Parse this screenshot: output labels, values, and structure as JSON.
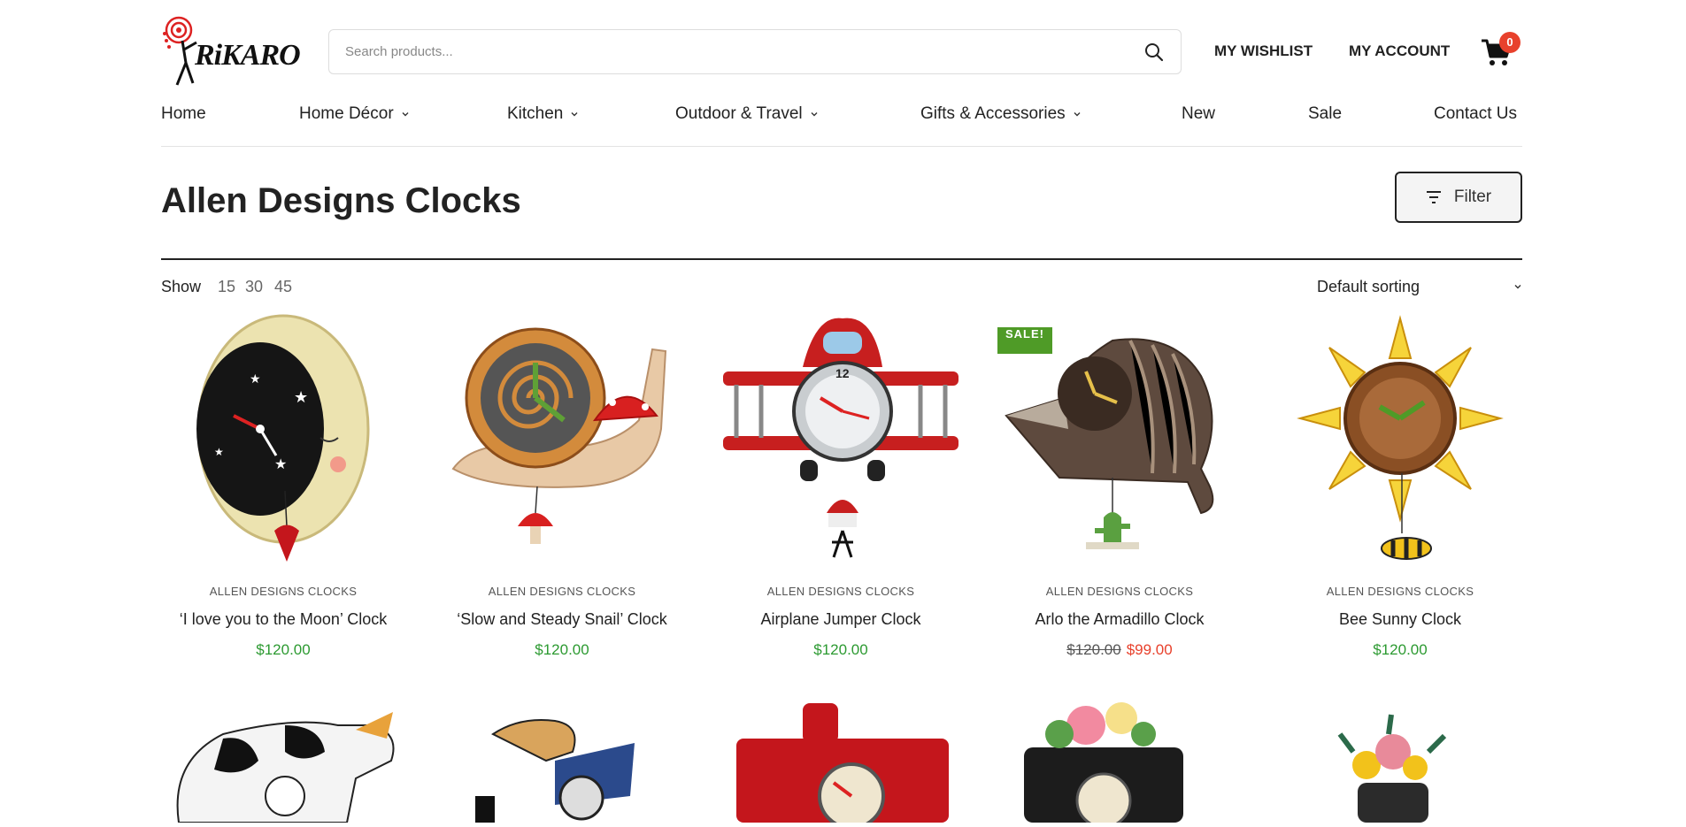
{
  "brand": {
    "logo_text": "RiKARO"
  },
  "search": {
    "placeholder": "Search products..."
  },
  "header": {
    "wishlist": "MY WISHLIST",
    "account": "MY ACCOUNT",
    "cart_count": "0"
  },
  "nav": [
    {
      "label": "Home"
    },
    {
      "label": "Home Décor"
    },
    {
      "label": "Kitchen"
    },
    {
      "label": "Outdoor & Travel"
    },
    {
      "label": "Gifts & Accessories"
    },
    {
      "label": "New"
    },
    {
      "label": "Sale"
    },
    {
      "label": "Contact Us"
    }
  ],
  "page": {
    "title": "Allen Designs Clocks",
    "filter_label": "Filter"
  },
  "toolbar": {
    "show_label": "Show",
    "show_options": [
      "15",
      "30",
      "45"
    ],
    "sort_label": "Default sorting"
  },
  "products": [
    {
      "category": "ALLEN DESIGNS CLOCKS",
      "name": "‘I love you to the Moon’ Clock",
      "price": "$120.00"
    },
    {
      "category": "ALLEN DESIGNS CLOCKS",
      "name": "‘Slow and Steady Snail’ Clock",
      "price": "$120.00"
    },
    {
      "category": "ALLEN DESIGNS CLOCKS",
      "name": "Airplane Jumper Clock",
      "price": "$120.00"
    },
    {
      "category": "ALLEN DESIGNS CLOCKS",
      "name": "Arlo the Armadillo Clock",
      "old_price": "$120.00",
      "price": "$99.00",
      "badge": "SALE!"
    },
    {
      "category": "ALLEN DESIGNS CLOCKS",
      "name": "Bee Sunny Clock",
      "price": "$120.00"
    }
  ],
  "colors": {
    "price_green": "#2c9a31",
    "sale_red": "#e8412c",
    "badge_green": "#4f9b27",
    "text_dark": "#222222"
  }
}
